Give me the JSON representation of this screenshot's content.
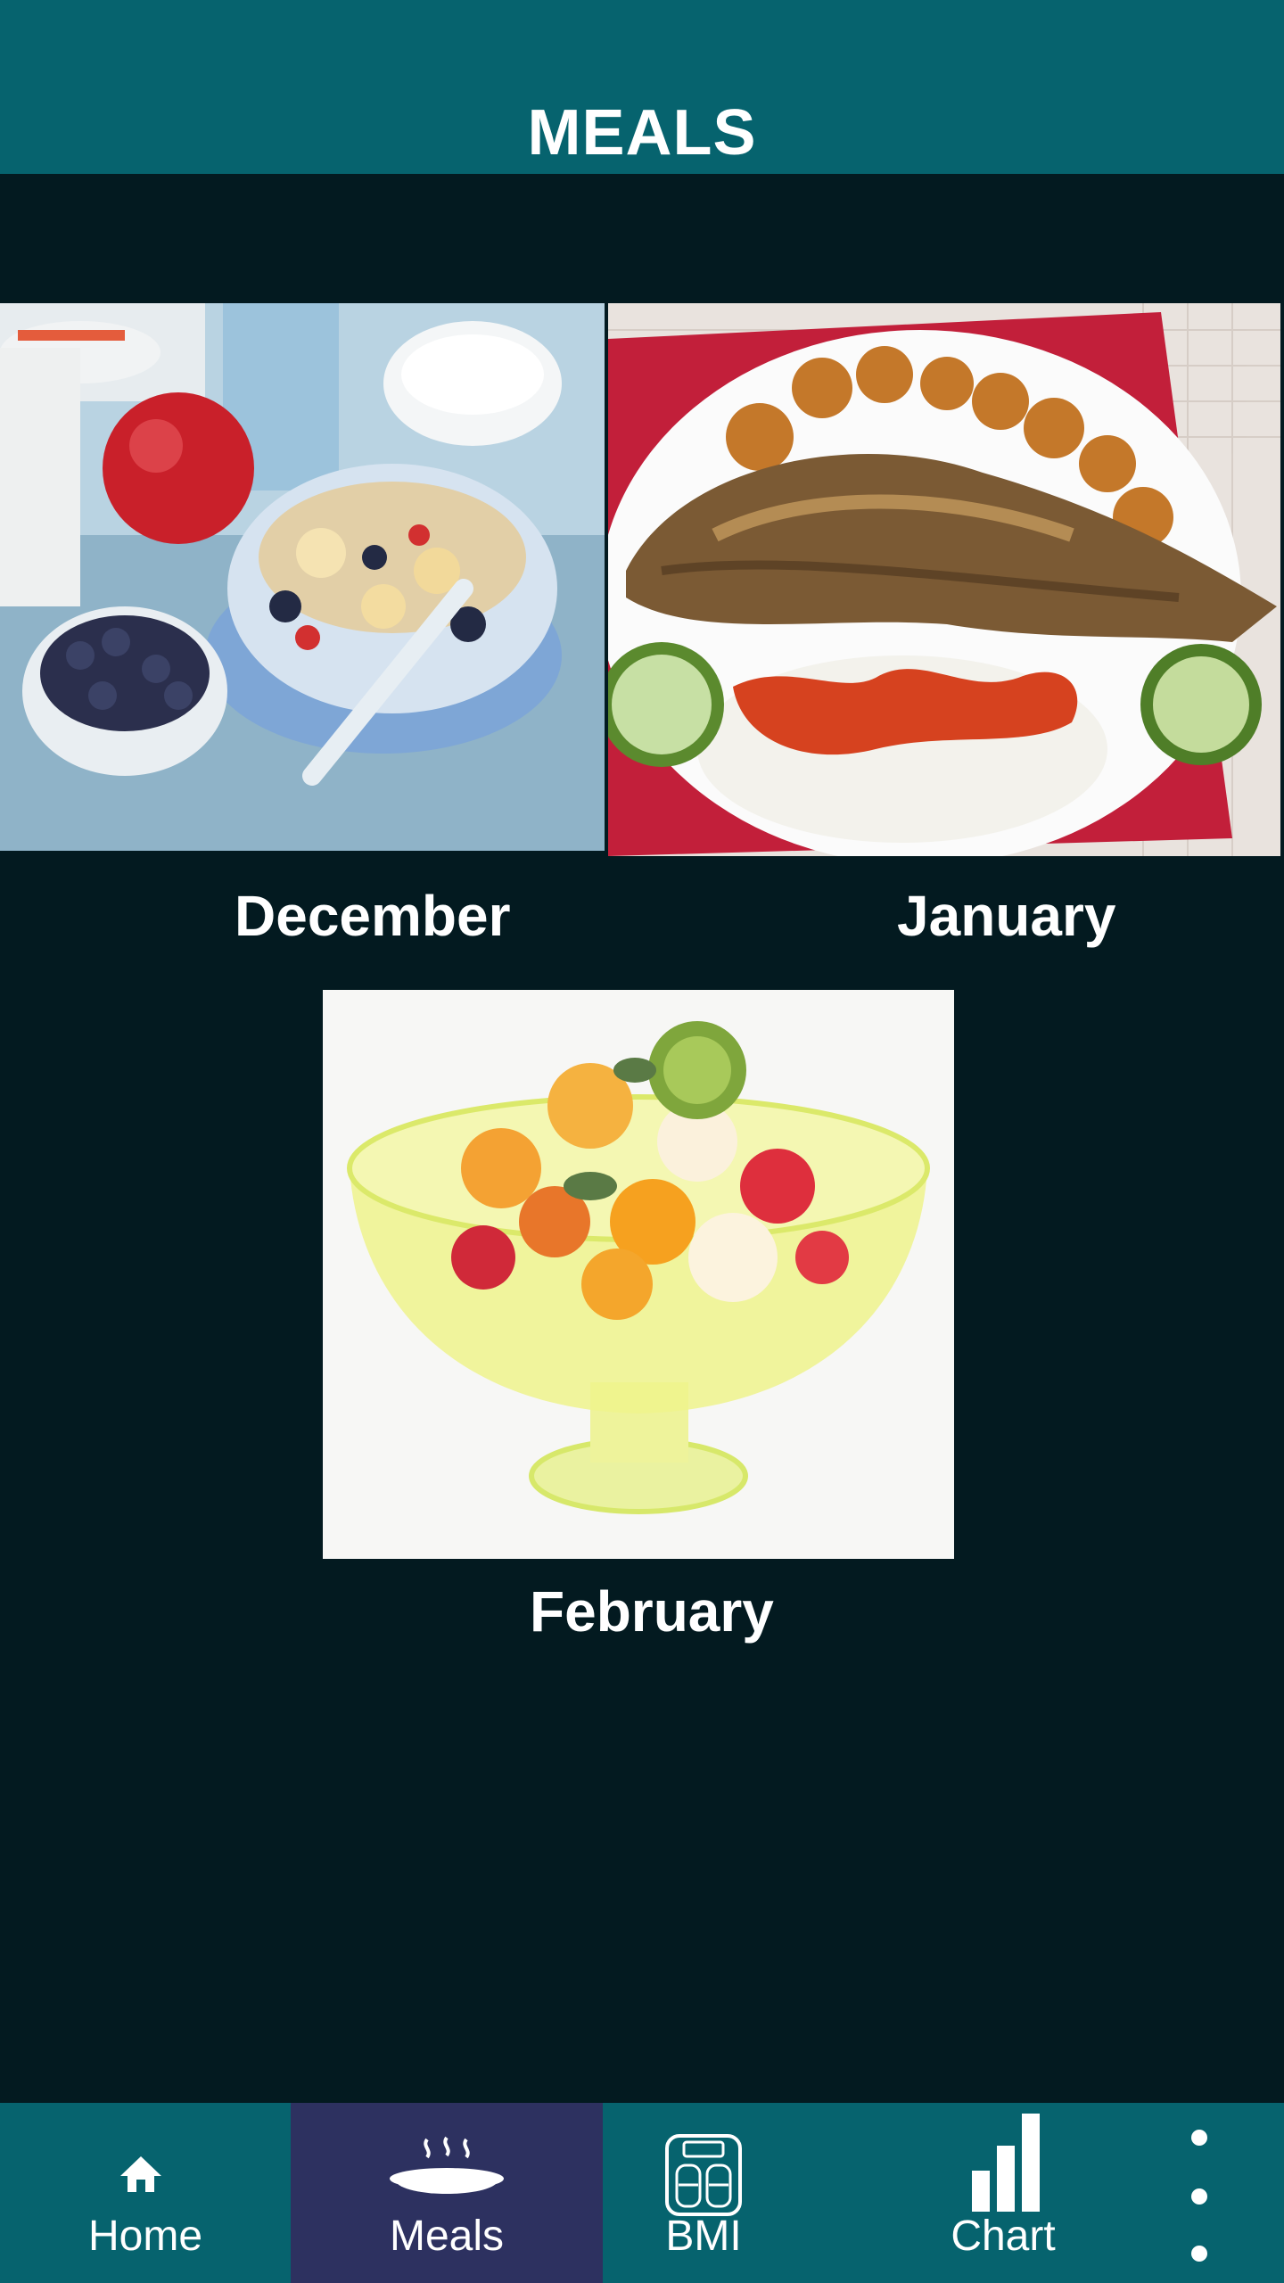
{
  "header": {
    "title": "MEALS"
  },
  "meals": [
    {
      "label": "December",
      "image": "breakfast-cereal-fruit-photo"
    },
    {
      "label": "January",
      "image": "grilled-fish-rice-plantain-photo"
    },
    {
      "label": "February",
      "image": "fruit-salad-bowl-photo"
    }
  ],
  "nav": {
    "home": {
      "label": "Home",
      "icon": "home-icon"
    },
    "meals": {
      "label": "Meals",
      "icon": "steaming-dish-icon"
    },
    "bmi": {
      "label": "BMI",
      "icon": "scale-icon"
    },
    "chart": {
      "label": "Chart",
      "icon": "bar-chart-icon"
    },
    "more": {
      "icon": "more-vertical-icon"
    }
  },
  "colors": {
    "header": "#06636e",
    "background": "#031a20",
    "nav_active": "#2d3160",
    "text": "#ffffff"
  }
}
